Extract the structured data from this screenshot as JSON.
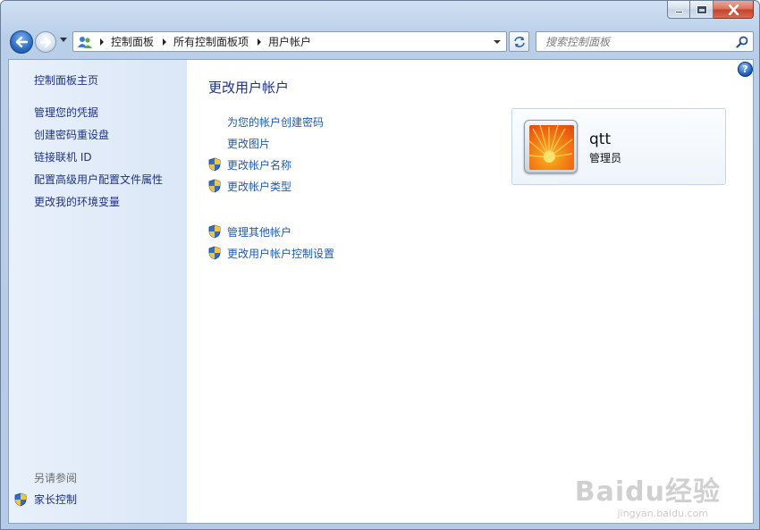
{
  "nav": {
    "breadcrumbs": [
      "控制面板",
      "所有控制面板项",
      "用户帐户"
    ],
    "search_placeholder": "搜索控制面板"
  },
  "sidebar": {
    "home": "控制面板主页",
    "links": [
      "管理您的凭据",
      "创建密码重设盘",
      "链接联机 ID",
      "配置高级用户配置文件属性",
      "更改我的环境变量"
    ],
    "see_also_heading": "另请参阅",
    "see_also_links": [
      "家长控制"
    ]
  },
  "main": {
    "title": "更改用户帐户",
    "tasks": [
      {
        "label": "为您的帐户创建密码",
        "icon": ""
      },
      {
        "label": "更改图片",
        "icon": ""
      },
      {
        "label": "更改帐户名称",
        "icon": "uac-shield-icon"
      },
      {
        "label": "更改帐户类型",
        "icon": "uac-shield-icon"
      }
    ],
    "other_tasks": [
      {
        "label": "管理其他帐户",
        "icon": "uac-shield-icon"
      },
      {
        "label": "更改用户帐户控制设置",
        "icon": "uac-shield-icon"
      }
    ]
  },
  "account": {
    "name": "qtt",
    "role": "管理员"
  },
  "watermark": {
    "logo": "Baidu经验",
    "url": "jingyan.baidu.com"
  }
}
